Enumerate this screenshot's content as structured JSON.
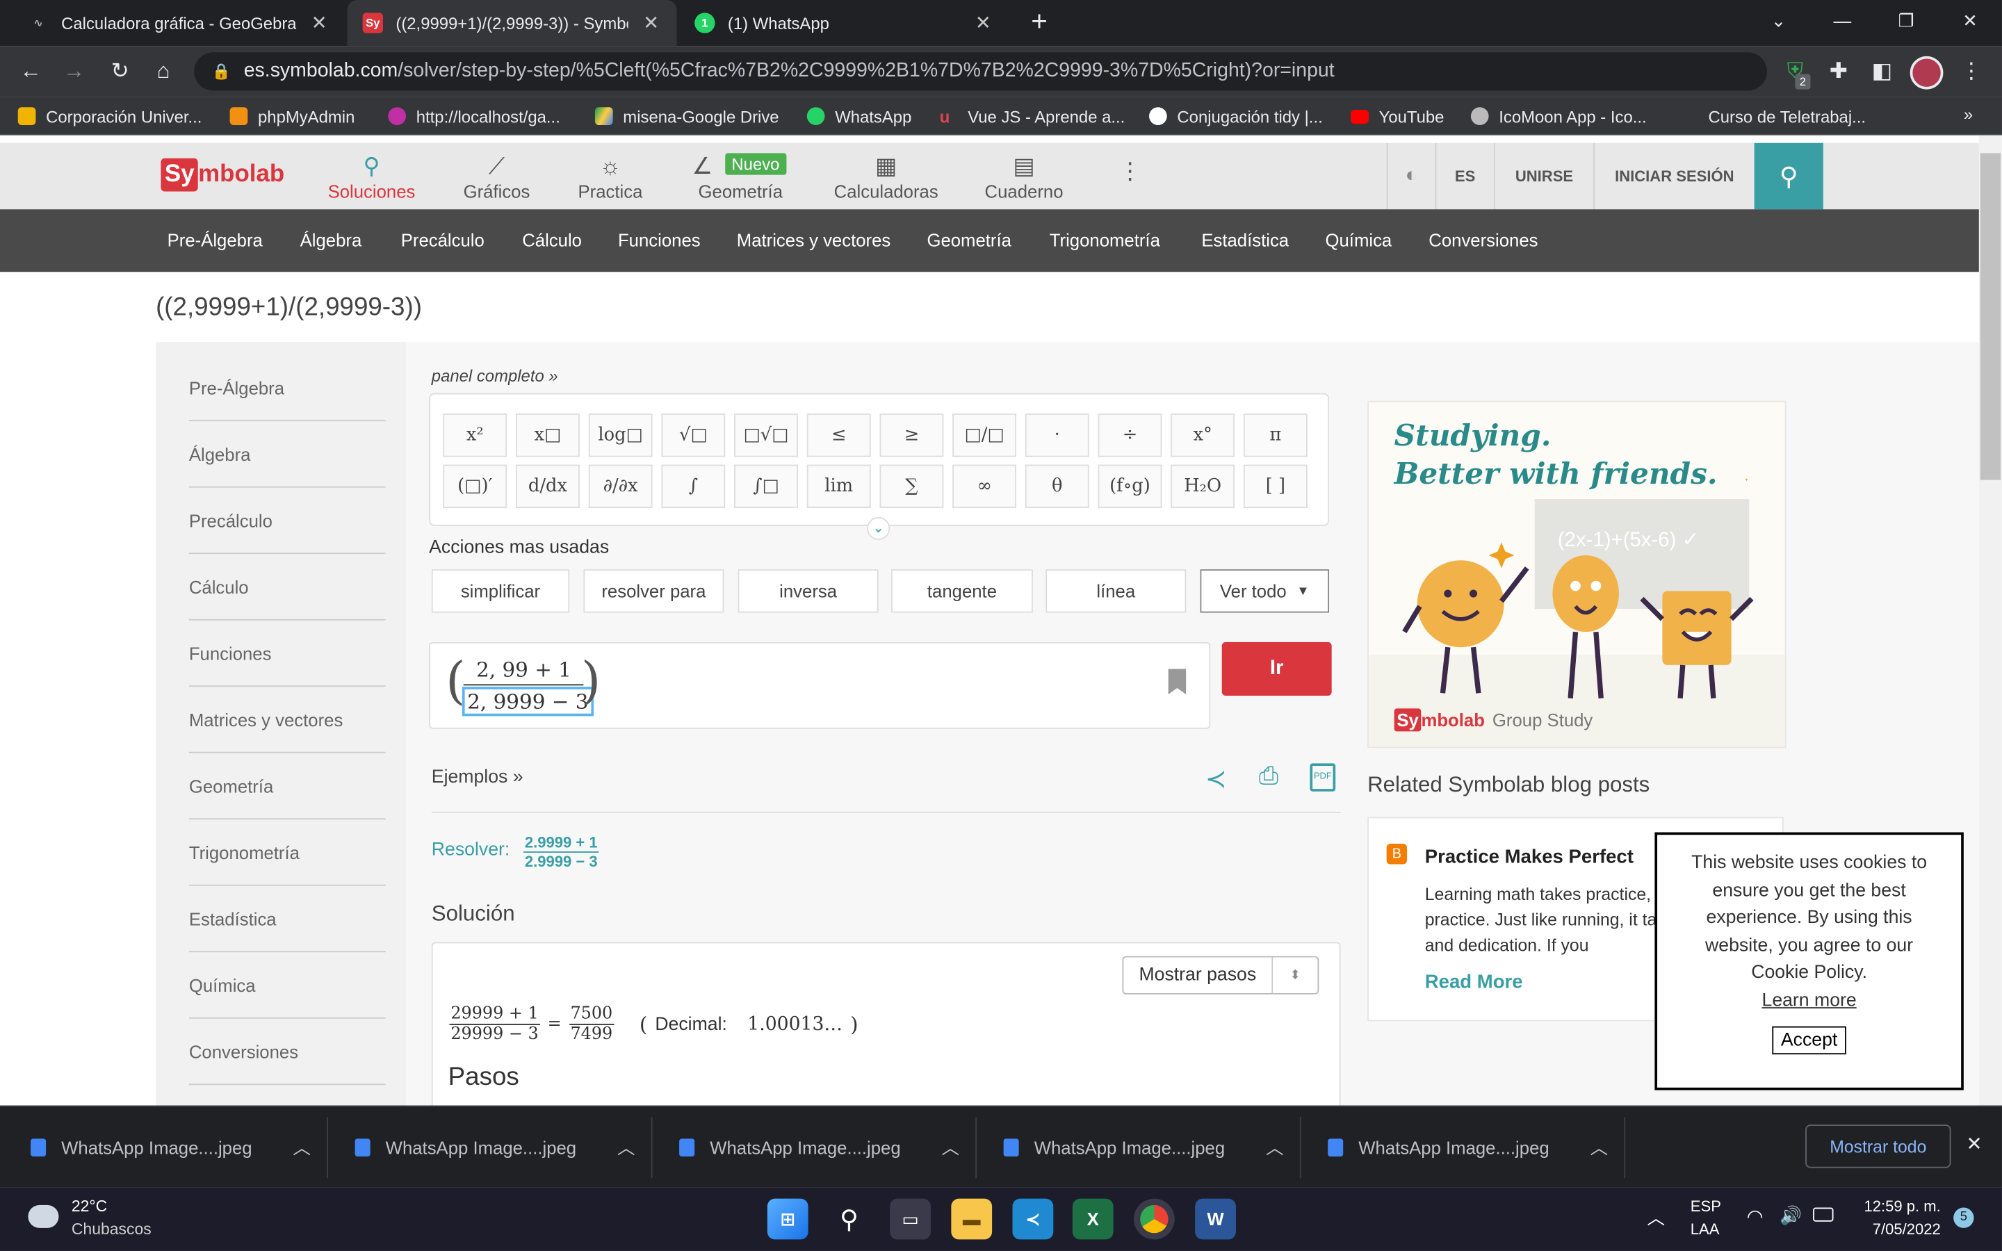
{
  "browser": {
    "tabs": [
      {
        "title": "Calculadora gráfica - GeoGebra",
        "icon": "geogebra-icon"
      },
      {
        "title": "((2,9999+1)/(2,9999-3)) - Symbol",
        "icon": "symbolab-icon"
      },
      {
        "title": "(1) WhatsApp",
        "icon": "whatsapp-icon"
      }
    ],
    "url_host": "es.symbolab.com",
    "url_path": "/solver/step-by-step/%5Cleft(%5Cfrac%7B2%2C9999%2B1%7D%7B2%2C9999-3%7D%5Cright)?or=input",
    "extension_badge": "2",
    "bookmarks": [
      "Corporación Univer...",
      "phpMyAdmin",
      "http://localhost/ga...",
      "misena-Google Drive",
      "WhatsApp",
      "Vue JS - Aprende a...",
      "Conjugación tidy |...",
      "YouTube",
      "IcoMoon App - Ico...",
      "Curso de Teletrabaj..."
    ],
    "bookmarks_more": "»"
  },
  "site": {
    "logo_sy": "Sy",
    "logo_rest": "mbolab",
    "nav": [
      {
        "label": "Soluciones",
        "icon": "search-icon",
        "active": true
      },
      {
        "label": "Gráficos",
        "icon": "chart-icon"
      },
      {
        "label": "Practica",
        "icon": "bulb-icon"
      },
      {
        "label": "Geometría",
        "icon": "angle-icon",
        "badge": "Nuevo"
      },
      {
        "label": "Calculadoras",
        "icon": "calculator-icon"
      },
      {
        "label": "Cuaderno",
        "icon": "notebook-icon"
      }
    ],
    "lang": "ES",
    "join": "UNIRSE",
    "login": "INICIAR SESIÓN",
    "categories": [
      "Pre-Álgebra",
      "Álgebra",
      "Precálculo",
      "Cálculo",
      "Funciones",
      "Matrices y vectores",
      "Geometría",
      "Trigonometría",
      "Estadística",
      "Química",
      "Conversiones"
    ]
  },
  "page": {
    "query_title": "((2,9999+1)/(2,9999-3))",
    "sidebar": [
      "Pre-Álgebra",
      "Álgebra",
      "Precálculo",
      "Cálculo",
      "Funciones",
      "Matrices y vectores",
      "Geometría",
      "Trigonometría",
      "Estadística",
      "Química",
      "Conversiones"
    ],
    "panel_link": "panel completo »",
    "keypad_row1": [
      "x²",
      "x□",
      "log□",
      "√□",
      "□√□",
      "≤",
      "≥",
      "□/□",
      "·",
      "÷",
      "x°",
      "π"
    ],
    "keypad_row2": [
      "(□)′",
      "d/dx",
      "∂/∂x",
      "∫",
      "∫□",
      "lim",
      "∑",
      "∞",
      "θ",
      "(f∘g)",
      "H₂O",
      "[ ]"
    ],
    "actions_title": "Acciones mas usadas",
    "actions": [
      "simplificar",
      "resolver para",
      "inversa",
      "tangente",
      "línea"
    ],
    "see_all": "Ver todo",
    "input_numerator": "2, 99 + 1",
    "input_denominator": "2, 9999 − 3",
    "go_button": "Ir",
    "examples_link": "Ejemplos »",
    "resolve_label": "Resolver:",
    "resolve_num": "2.9999 + 1",
    "resolve_den": "2.9999 − 3",
    "solution_title": "Solución",
    "show_steps": "Mostrar pasos",
    "result_num": "29999 + 1",
    "result_den": "29999 − 3",
    "result_eq": "=",
    "result_frac_num": "7500",
    "result_frac_den": "7499",
    "decimal_label": "Decimal:",
    "decimal_value": "1.00013…",
    "steps_title": "Pasos"
  },
  "ad": {
    "line1": "Studying.",
    "line2": "Better with friends.",
    "board_text": "(2x-1)+(5x-6) ✓",
    "brand_sy": "Sy",
    "brand_rest": "mbolab",
    "brand_suffix": "Group Study"
  },
  "blog": {
    "heading": "Related Symbolab blog posts",
    "post_title": "Practice Makes Perfect",
    "post_text": "Learning math takes practice, lots of practice. Just like running, it takes practice and dedication. If you",
    "read_more": "Read More"
  },
  "cookie": {
    "text": "This website uses cookies to ensure you get the best experience. By using this website, you agree to our Cookie Policy.",
    "learn_more": "Learn more",
    "accept": "Accept"
  },
  "downloads": {
    "items": [
      "WhatsApp Image....jpeg",
      "WhatsApp Image....jpeg",
      "WhatsApp Image....jpeg",
      "WhatsApp Image....jpeg",
      "WhatsApp Image....jpeg"
    ],
    "show_all": "Mostrar todo"
  },
  "taskbar": {
    "temp": "22°C",
    "weather": "Chubascos",
    "lang1": "ESP",
    "lang2": "LAA",
    "time": "12:59 p. m.",
    "date": "7/05/2022",
    "notif": "5"
  },
  "colors": {
    "brand_red": "#d9363e",
    "teal": "#3a9ea5",
    "ad_teal": "#2a8a8a"
  }
}
